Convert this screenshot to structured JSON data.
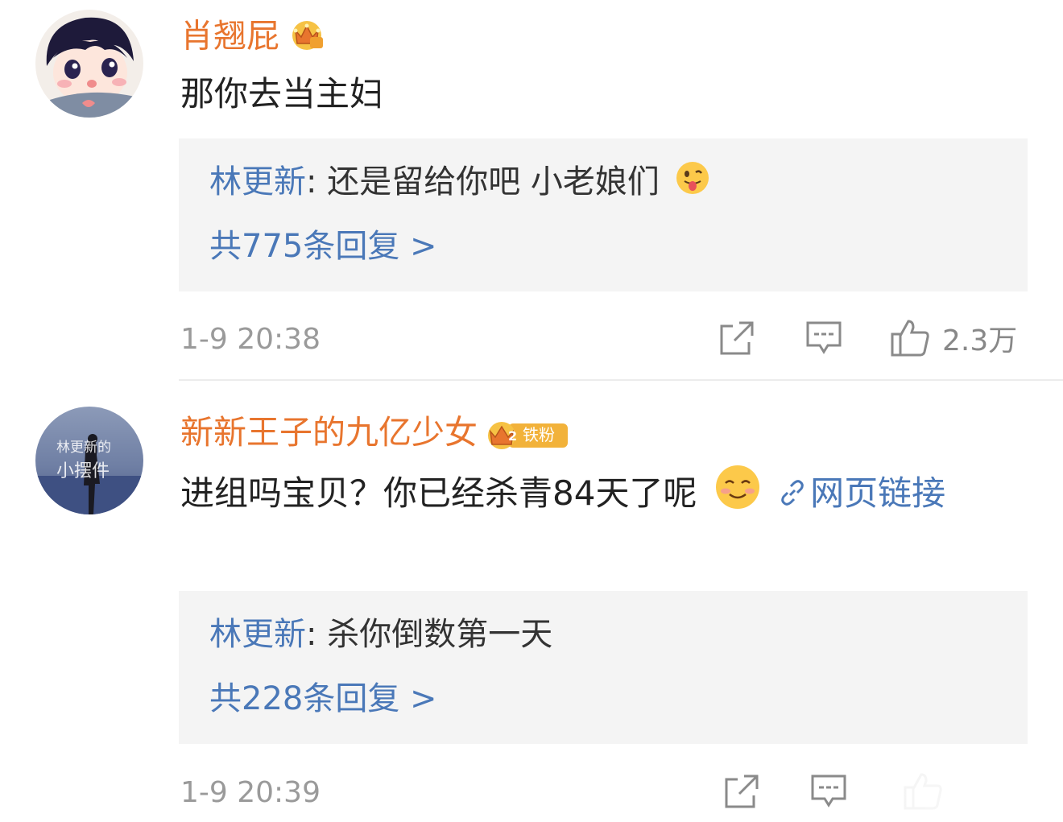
{
  "comments": [
    {
      "username": "肖翘屁",
      "text": "那你去当主妇",
      "reply": {
        "author": "林更新",
        "text": "还是留给你吧 小老娘们",
        "count_label": "共775条回复 >"
      },
      "timestamp": "1-9 20:38",
      "likes": "2.3万",
      "avatar": "cartoon-boy-avatar",
      "badge": "crown-icon"
    },
    {
      "username": "新新王子的九亿少女",
      "fan_badge": "铁粉",
      "fan_level": "2",
      "text": "进组吗宝贝？你已经杀青84天了呢",
      "link_label": "网页链接",
      "reply": {
        "author": "林更新",
        "text": "杀你倒数第一天",
        "count_label": "共228条回复 >"
      },
      "timestamp": "1-9 20:39",
      "avatar": "photo-avatar",
      "avatar_caption_1": "林更新的",
      "avatar_caption_2": "小摆件"
    }
  ],
  "colors": {
    "username": "#e8752e",
    "link": "#4a78b8",
    "reply_bg": "#f4f4f4",
    "meta": "#9a9a9a"
  }
}
